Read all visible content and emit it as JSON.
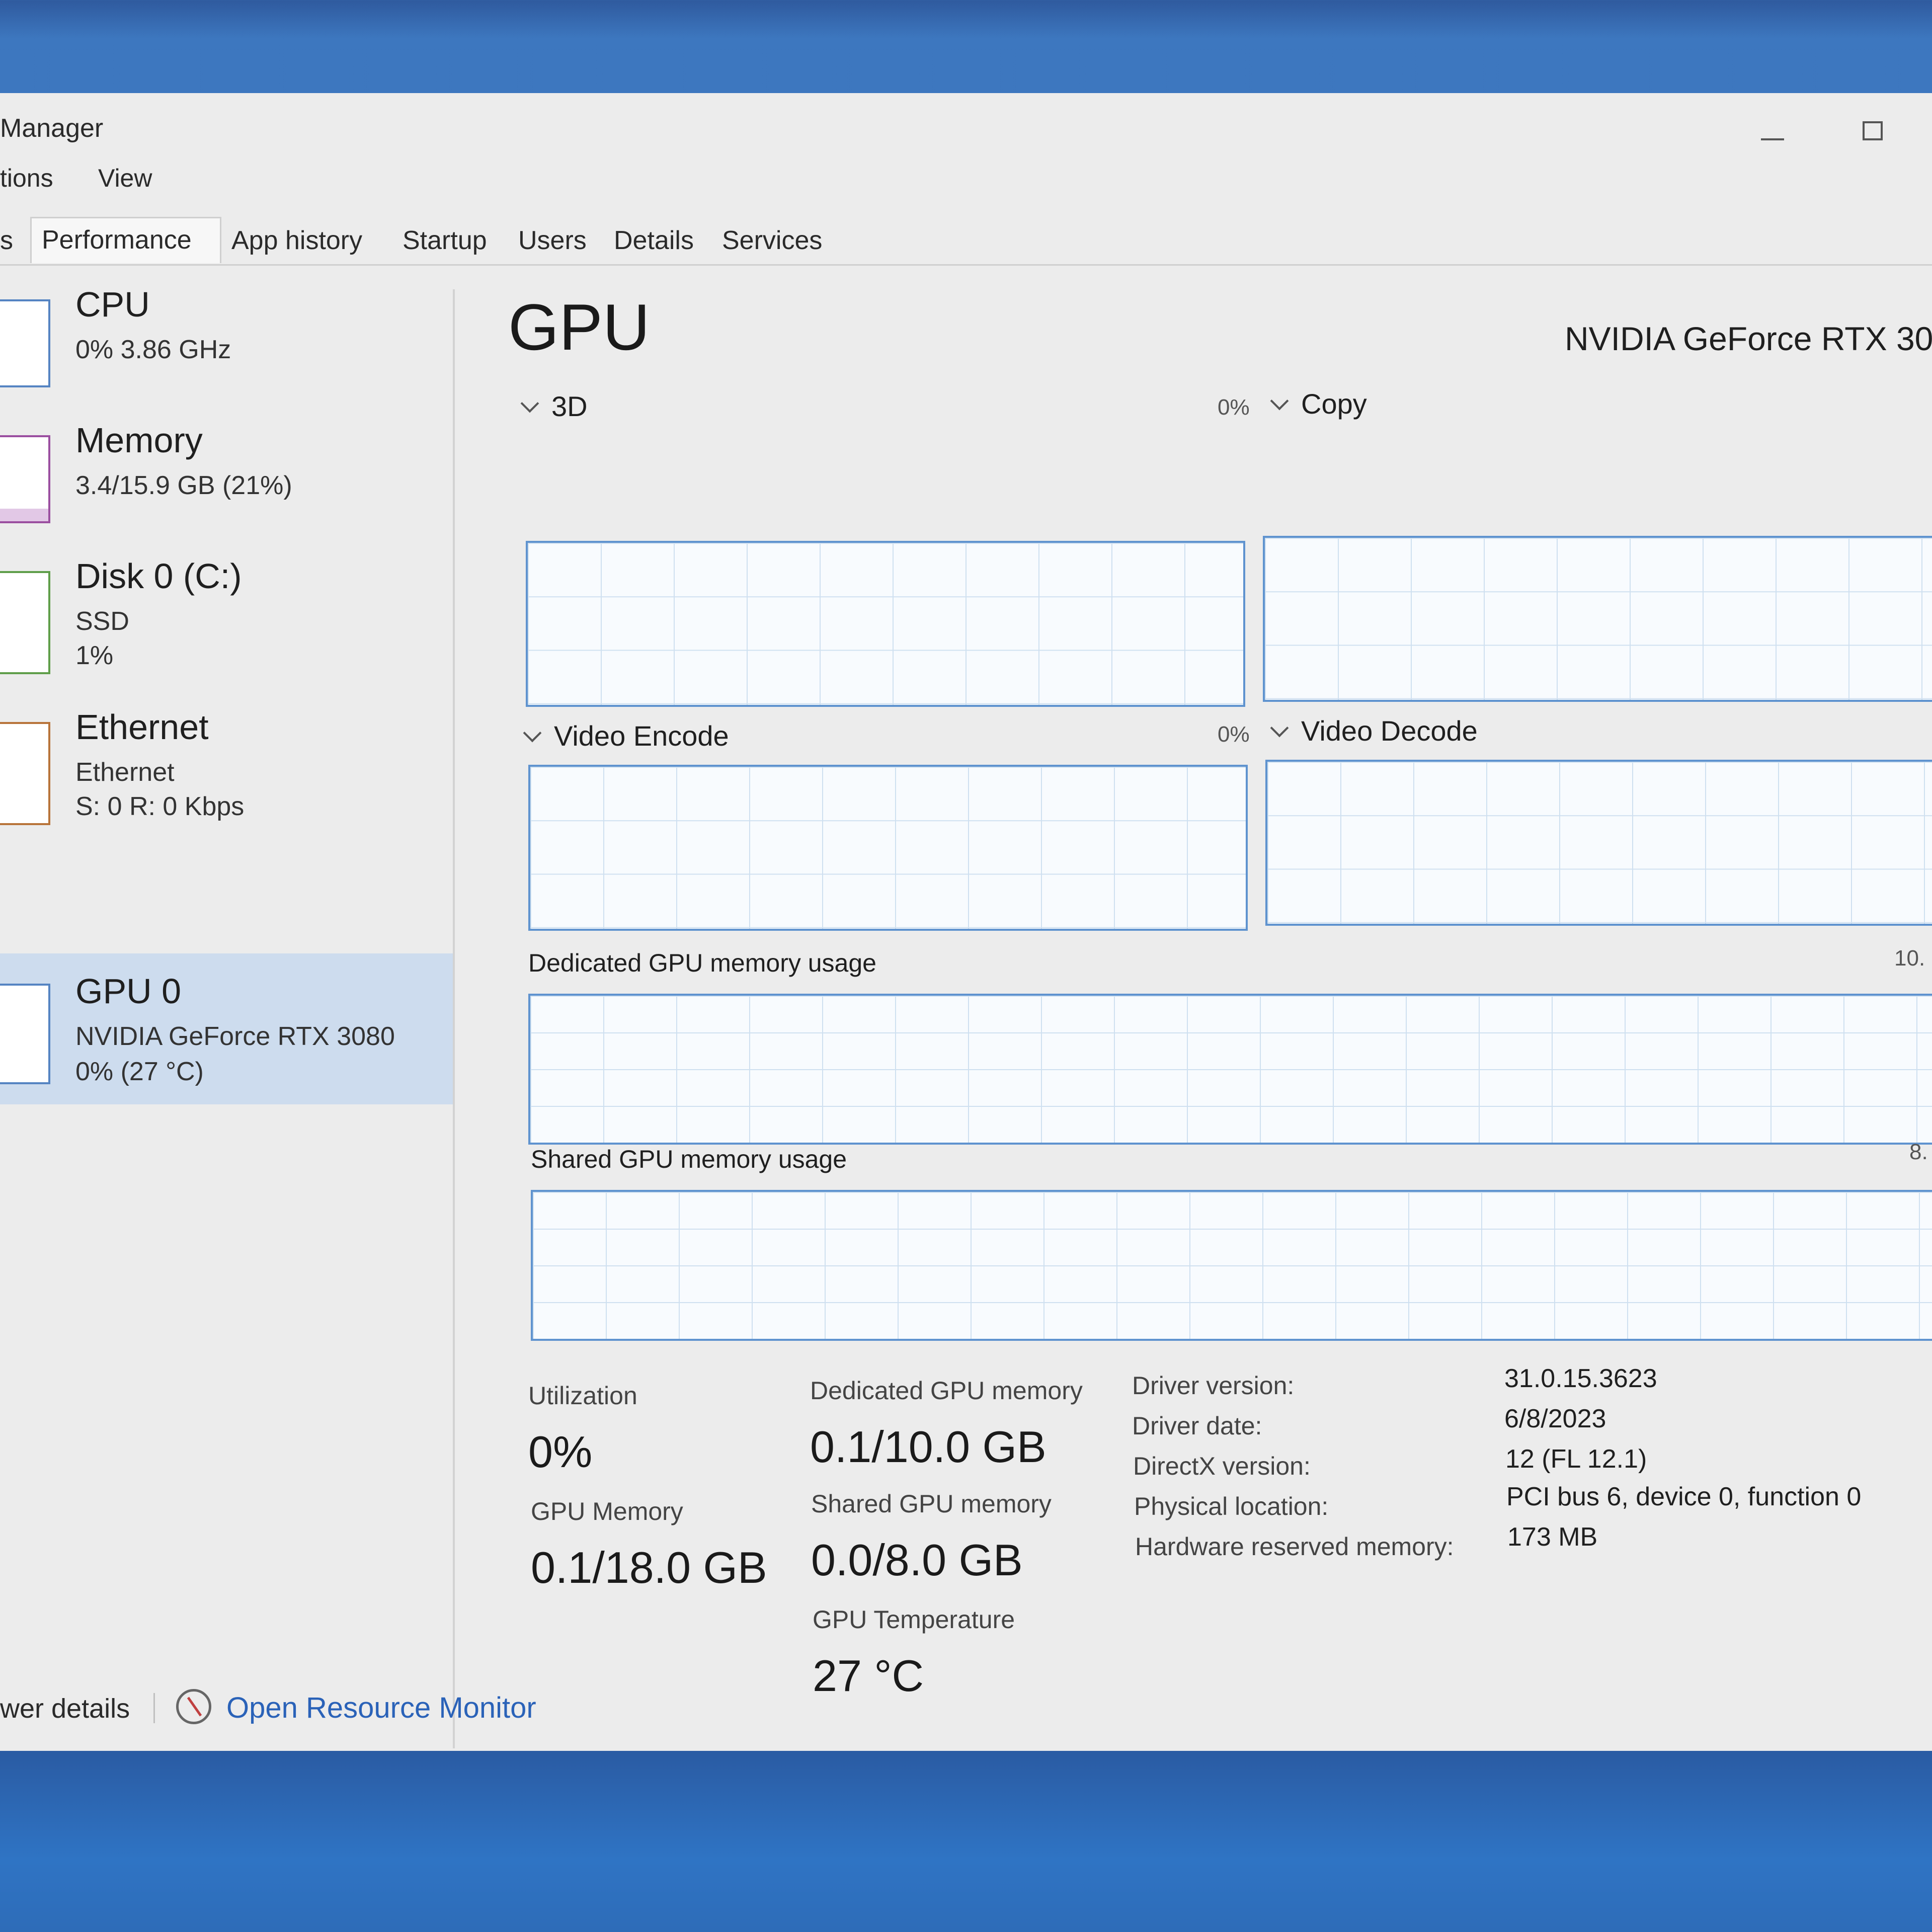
{
  "window": {
    "title": "Manager"
  },
  "menu": [
    "tions",
    "View"
  ],
  "tabs": [
    "s",
    "Performance",
    "App history",
    "Startup",
    "Users",
    "Details",
    "Services"
  ],
  "sidebar": {
    "items": [
      {
        "name": "CPU",
        "lines": [
          "0%  3.86 GHz"
        ]
      },
      {
        "name": "Memory",
        "lines": [
          "3.4/15.9 GB (21%)"
        ]
      },
      {
        "name": "Disk 0 (C:)",
        "lines": [
          "SSD",
          "1%"
        ]
      },
      {
        "name": "Ethernet",
        "lines": [
          "Ethernet",
          "S: 0  R: 0 Kbps"
        ]
      },
      {
        "name": "GPU 0",
        "lines": [
          "NVIDIA GeForce RTX 3080",
          "0%  (27 °C)"
        ]
      }
    ]
  },
  "main": {
    "title": "GPU",
    "model": "NVIDIA GeForce RTX 30",
    "graphs": {
      "g3d": {
        "label": "3D",
        "pct": "0%"
      },
      "copy": {
        "label": "Copy"
      },
      "encode": {
        "label": "Video Encode",
        "pct": "0%"
      },
      "decode": {
        "label": "Video Decode"
      },
      "dedicated": {
        "label": "Dedicated GPU memory usage",
        "max": "10."
      },
      "shared": {
        "label": "Shared GPU memory usage",
        "max": "8."
      }
    },
    "stats": {
      "utilization_label": "Utilization",
      "utilization_value": "0%",
      "gpu_memory_label": "GPU Memory",
      "gpu_memory_value": "0.1/18.0 GB",
      "dedicated_label": "Dedicated GPU memory",
      "dedicated_value": "0.1/10.0 GB",
      "shared_label": "Shared GPU memory",
      "shared_value": "0.0/8.0 GB",
      "temp_label": "GPU Temperature",
      "temp_value": "27 °C"
    },
    "info": [
      {
        "key": "Driver version:",
        "value": "31.0.15.3623"
      },
      {
        "key": "Driver date:",
        "value": "6/8/2023"
      },
      {
        "key": "DirectX version:",
        "value": "12 (FL 12.1)"
      },
      {
        "key": "Physical location:",
        "value": "PCI bus 6, device 0, function 0"
      },
      {
        "key": "Hardware reserved memory:",
        "value": "173 MB"
      }
    ]
  },
  "footer": {
    "fewer_details": "wer details",
    "resource_monitor": "Open Resource Monitor"
  },
  "colors": {
    "accent": "#5f93cf",
    "link": "#2a62b8",
    "selected": "#cddcee"
  }
}
